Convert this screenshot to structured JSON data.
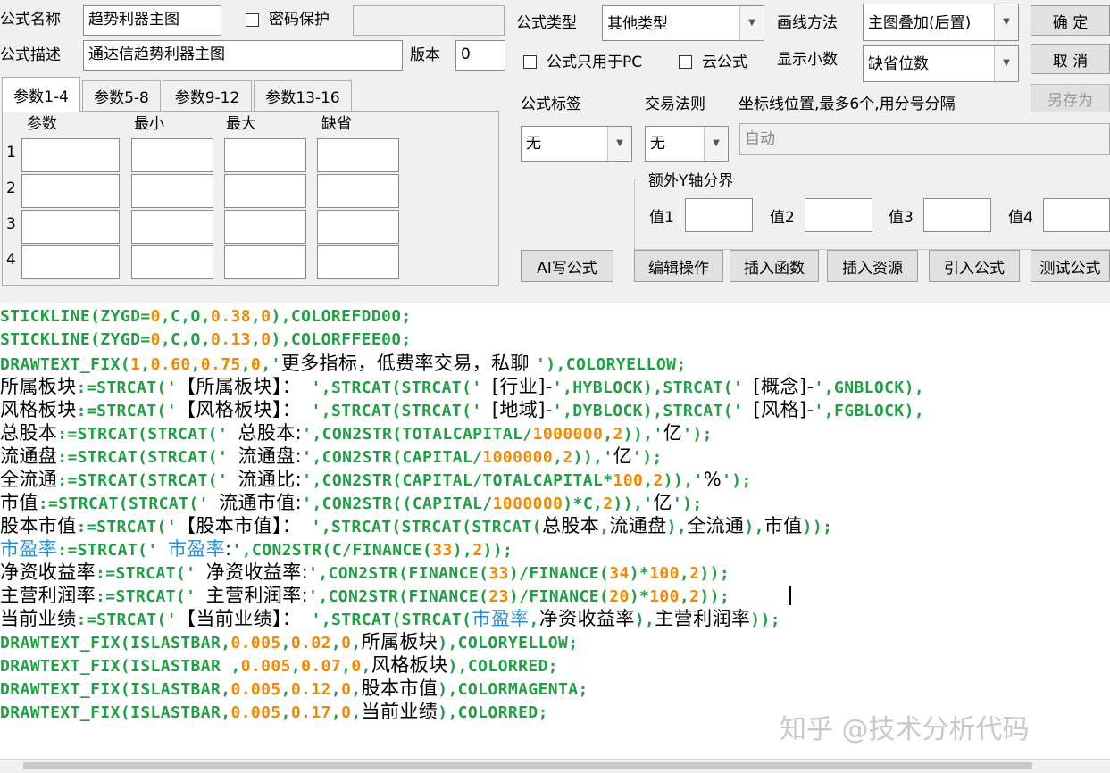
{
  "header": {
    "formula_name_label": "公式名称",
    "formula_name_value": "趋势利器主图",
    "password_label": "密码保护",
    "password_value": "",
    "formula_desc_label": "公式描述",
    "formula_desc_value": "通达信趋势利器主图",
    "version_label": "版本",
    "version_value": "0"
  },
  "options": {
    "formula_type_label": "公式类型",
    "formula_type_value": "其他类型",
    "draw_method_label": "画线方法",
    "draw_method_value": "主图叠加(后置)",
    "pc_only_label": "公式只用于PC",
    "cloud_label": "云公式",
    "decimals_label": "显示小数",
    "decimals_value": "缺省位数",
    "formula_tag_label": "公式标签",
    "formula_tag_value": "无",
    "trade_rule_label": "交易法则",
    "trade_rule_value": "无",
    "axis_label": "坐标线位置,最多6个,用分号分隔",
    "axis_value": "自动",
    "extra_y_title": "额外Y轴分界",
    "extra_y_labels": [
      "值1",
      "值2",
      "值3",
      "值4"
    ]
  },
  "buttons": {
    "ok": "确  定",
    "cancel": "取  消",
    "save_as": "另存为",
    "ai_write": "AI写公式",
    "edit_ops": "编辑操作",
    "insert_func": "插入函数",
    "insert_res": "插入资源",
    "import_formula": "引入公式",
    "test_formula": "测试公式"
  },
  "params": {
    "tabs": [
      "参数1-4",
      "参数5-8",
      "参数9-12",
      "参数13-16"
    ],
    "columns": [
      "参数",
      "最小",
      "最大",
      "缺省"
    ],
    "rows": [
      "1",
      "2",
      "3",
      "4"
    ]
  },
  "colors": {
    "green": "#1fa043",
    "orange": "#f28a00",
    "blue": "#2b8fd6",
    "black": "#000000"
  },
  "code": [
    [
      [
        "g",
        "STICKLINE(ZYGD="
      ],
      [
        "o",
        "0"
      ],
      [
        "g",
        ",C,O,"
      ],
      [
        "o",
        "0.38"
      ],
      [
        "g",
        ","
      ],
      [
        "o",
        "0"
      ],
      [
        "g",
        "),COLOREFDD00;"
      ]
    ],
    [
      [
        "g",
        "STICKLINE(ZYGD="
      ],
      [
        "o",
        "0"
      ],
      [
        "g",
        ",C,O,"
      ],
      [
        "o",
        "0.13"
      ],
      [
        "g",
        ","
      ],
      [
        "o",
        "0"
      ],
      [
        "g",
        "),COLORFFEE00;"
      ]
    ],
    [
      [
        "g",
        "DRAWTEXT_FIX("
      ],
      [
        "o",
        "1"
      ],
      [
        "g",
        ","
      ],
      [
        "o",
        "0.60"
      ],
      [
        "g",
        ","
      ],
      [
        "o",
        "0.75"
      ],
      [
        "g",
        ","
      ],
      [
        "o",
        "0"
      ],
      [
        "g",
        ",'"
      ],
      [
        "k",
        "更多指标，低费率交易，私聊 "
      ],
      [
        "g",
        "'),COLORYELLOW;"
      ]
    ],
    [
      [
        "k",
        "所属板块"
      ],
      [
        "g",
        ":=STRCAT('"
      ],
      [
        "k",
        "【所属板块】："
      ],
      [
        "g",
        " ',STRCAT(STRCAT(' "
      ],
      [
        "k",
        "[行业]-"
      ],
      [
        "g",
        "',HYBLOCK),STRCAT(' "
      ],
      [
        "k",
        "[概念]-"
      ],
      [
        "g",
        "',GNBLOCK),"
      ]
    ],
    [
      [
        "k",
        "风格板块"
      ],
      [
        "g",
        ":=STRCAT('"
      ],
      [
        "k",
        "【风格板块】："
      ],
      [
        "g",
        " ',STRCAT(STRCAT(' "
      ],
      [
        "k",
        "[地域]-"
      ],
      [
        "g",
        "',DYBLOCK),STRCAT(' "
      ],
      [
        "k",
        "[风格]-"
      ],
      [
        "g",
        "',FGBLOCK),"
      ]
    ],
    [
      [
        "k",
        "总股本"
      ],
      [
        "g",
        ":=STRCAT(STRCAT(' "
      ],
      [
        "k",
        "总股本:"
      ],
      [
        "g",
        "',CON2STR(TOTALCAPITAL/"
      ],
      [
        "o",
        "1000000"
      ],
      [
        "g",
        ","
      ],
      [
        "o",
        "2"
      ],
      [
        "g",
        "))"
      ],
      [
        "g",
        ",'"
      ],
      [
        "k",
        "亿"
      ],
      [
        "g",
        "');"
      ]
    ],
    [
      [
        "k",
        "流通盘"
      ],
      [
        "g",
        ":=STRCAT(STRCAT(' "
      ],
      [
        "k",
        "流通盘:"
      ],
      [
        "g",
        "',CON2STR(CAPITAL/"
      ],
      [
        "o",
        "1000000"
      ],
      [
        "g",
        ","
      ],
      [
        "o",
        "2"
      ],
      [
        "g",
        "))"
      ],
      [
        "g",
        ",'"
      ],
      [
        "k",
        "亿"
      ],
      [
        "g",
        "');"
      ]
    ],
    [
      [
        "k",
        "全流通"
      ],
      [
        "g",
        ":=STRCAT(STRCAT(' "
      ],
      [
        "k",
        "流通比:"
      ],
      [
        "g",
        "',CON2STR(CAPITAL/TOTALCAPITAL*"
      ],
      [
        "o",
        "100"
      ],
      [
        "g",
        ","
      ],
      [
        "o",
        "2"
      ],
      [
        "g",
        "))"
      ],
      [
        "g",
        ",'"
      ],
      [
        "k",
        "%"
      ],
      [
        "g",
        "');"
      ]
    ],
    [
      [
        "k",
        "市值"
      ],
      [
        "g",
        ":=STRCAT(STRCAT(' "
      ],
      [
        "k",
        "流通市值:"
      ],
      [
        "g",
        "',CON2STR((CAPITAL/"
      ],
      [
        "o",
        "1000000"
      ],
      [
        "g",
        ")*C,"
      ],
      [
        "o",
        "2"
      ],
      [
        "g",
        "))"
      ],
      [
        "g",
        ",'"
      ],
      [
        "k",
        "亿"
      ],
      [
        "g",
        "');"
      ]
    ],
    [
      [
        "k",
        "股本市值"
      ],
      [
        "g",
        ":=STRCAT('"
      ],
      [
        "k",
        "【股本市值】："
      ],
      [
        "g",
        " ',STRCAT(STRCAT(STRCAT("
      ],
      [
        "k",
        "总股本"
      ],
      [
        "g",
        ","
      ],
      [
        "k",
        "流通盘"
      ],
      [
        "g",
        "),"
      ],
      [
        "k",
        "全流通"
      ],
      [
        "g",
        "),"
      ],
      [
        "k",
        "市值"
      ],
      [
        "g",
        "));"
      ]
    ],
    [
      [
        "b",
        "市盈率"
      ],
      [
        "g",
        ":=STRCAT(' "
      ],
      [
        "b",
        "市盈率"
      ],
      [
        "k",
        ":"
      ],
      [
        "g",
        "',CON2STR(C/FINANCE("
      ],
      [
        "o",
        "33"
      ],
      [
        "g",
        "),"
      ],
      [
        "o",
        "2"
      ],
      [
        "g",
        "));"
      ]
    ],
    [
      [
        "k",
        "净资收益率"
      ],
      [
        "g",
        ":=STRCAT(' "
      ],
      [
        "k",
        "净资收益率:"
      ],
      [
        "g",
        "',CON2STR(FINANCE("
      ],
      [
        "o",
        "33"
      ],
      [
        "g",
        ")/FINANCE("
      ],
      [
        "o",
        "34"
      ],
      [
        "g",
        ")*"
      ],
      [
        "o",
        "100"
      ],
      [
        "g",
        ","
      ],
      [
        "o",
        "2"
      ],
      [
        "g",
        "));"
      ]
    ],
    [
      [
        "k",
        "主营利润率"
      ],
      [
        "g",
        ":=STRCAT(' "
      ],
      [
        "k",
        "主营利润率:"
      ],
      [
        "g",
        "',CON2STR(FINANCE("
      ],
      [
        "o",
        "23"
      ],
      [
        "g",
        ")/FINANCE("
      ],
      [
        "o",
        "20"
      ],
      [
        "g",
        ")*"
      ],
      [
        "o",
        "100"
      ],
      [
        "g",
        ","
      ],
      [
        "o",
        "2"
      ],
      [
        "g",
        "));"
      ]
    ],
    [
      [
        "k",
        "当前业绩"
      ],
      [
        "g",
        ":=STRCAT('"
      ],
      [
        "k",
        "【当前业绩】："
      ],
      [
        "g",
        " ',STRCAT(STRCAT("
      ],
      [
        "b",
        "市盈率"
      ],
      [
        "g",
        ","
      ],
      [
        "k",
        "净资收益率"
      ],
      [
        "g",
        "),"
      ],
      [
        "k",
        "主营利润率"
      ],
      [
        "g",
        "));"
      ]
    ],
    [
      [
        "g",
        "DRAWTEXT_FIX(ISLASTBAR,"
      ],
      [
        "o",
        "0.005"
      ],
      [
        "g",
        ","
      ],
      [
        "o",
        "0.02"
      ],
      [
        "g",
        ","
      ],
      [
        "o",
        "0"
      ],
      [
        "g",
        ","
      ],
      [
        "k",
        "所属板块"
      ],
      [
        "g",
        "),COLORYELLOW;"
      ]
    ],
    [
      [
        "g",
        "DRAWTEXT_FIX(ISLASTBAR ,"
      ],
      [
        "o",
        "0.005"
      ],
      [
        "g",
        ","
      ],
      [
        "o",
        "0.07"
      ],
      [
        "g",
        ","
      ],
      [
        "o",
        "0"
      ],
      [
        "g",
        ","
      ],
      [
        "k",
        "风格板块"
      ],
      [
        "g",
        "),COLORRED;"
      ]
    ],
    [
      [
        "g",
        "DRAWTEXT_FIX(ISLASTBAR,"
      ],
      [
        "o",
        "0.005"
      ],
      [
        "g",
        ","
      ],
      [
        "o",
        "0.12"
      ],
      [
        "g",
        ","
      ],
      [
        "o",
        "0"
      ],
      [
        "g",
        ","
      ],
      [
        "k",
        "股本市值"
      ],
      [
        "g",
        "),COLORMAGENTA;"
      ]
    ],
    [
      [
        "g",
        "DRAWTEXT_FIX(ISLASTBAR,"
      ],
      [
        "o",
        "0.005"
      ],
      [
        "g",
        ","
      ],
      [
        "o",
        "0.17"
      ],
      [
        "g",
        ","
      ],
      [
        "o",
        "0"
      ],
      [
        "g",
        ","
      ],
      [
        "k",
        "当前业绩"
      ],
      [
        "g",
        "),COLORRED;"
      ]
    ]
  ],
  "watermark": "知乎 @技术分析代码"
}
